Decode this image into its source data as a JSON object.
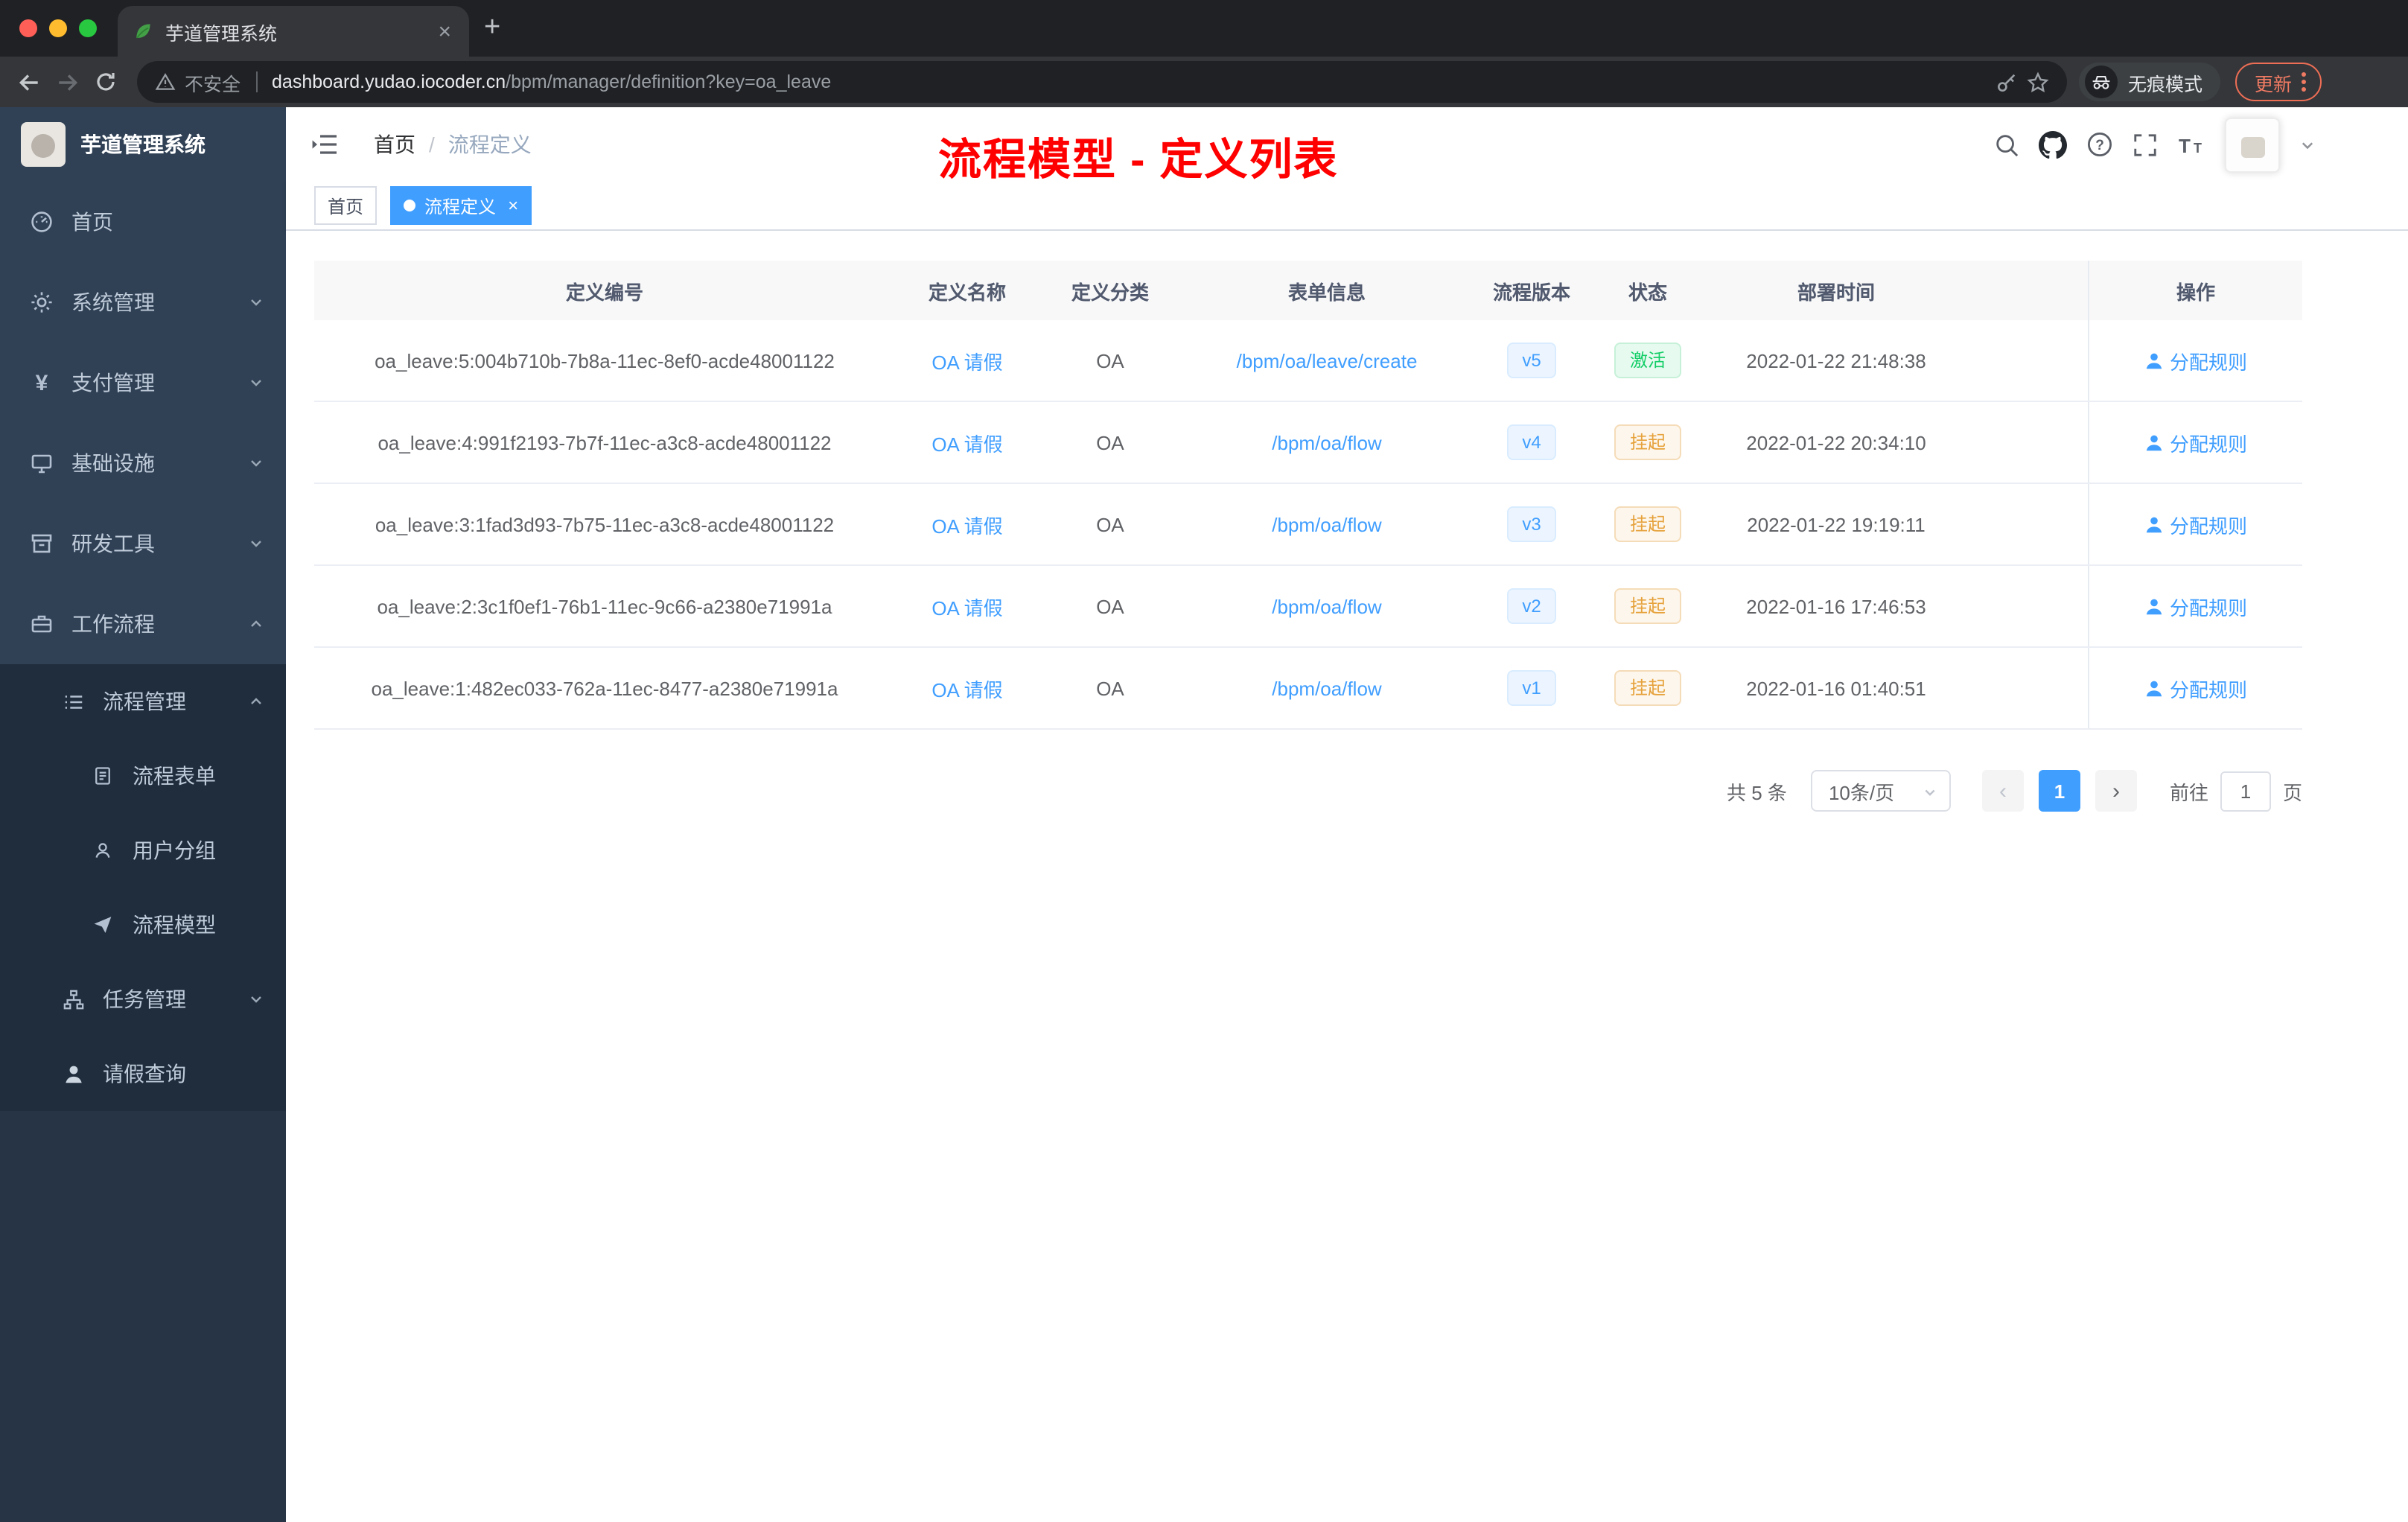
{
  "browser": {
    "tab_title": "芋道管理系统",
    "tab_close": "×",
    "new_tab": "+",
    "security_label": "不安全",
    "url_domain": "dashboard.yudao.iocoder.cn",
    "url_path": "/bpm/manager/definition?key=oa_leave",
    "incognito_label": "无痕模式",
    "update_label": "更新",
    "icons": {
      "favicon": "leaf",
      "back": "arrow-left",
      "forward": "arrow-right",
      "reload": "circular-arrow",
      "security": "alert-triangle",
      "key": "key",
      "star": "star-outline",
      "incognito": "spy-glasses",
      "menu": "vertical-dots"
    }
  },
  "sidebar": {
    "logo_title": "芋道管理系统",
    "items": [
      {
        "label": "首页",
        "icon": "dashboard"
      },
      {
        "label": "系统管理",
        "icon": "gear",
        "chevron": "down"
      },
      {
        "label": "支付管理",
        "icon": "yen",
        "chevron": "down"
      },
      {
        "label": "基础设施",
        "icon": "monitor",
        "chevron": "down"
      },
      {
        "label": "研发工具",
        "icon": "archive",
        "chevron": "down"
      },
      {
        "label": "工作流程",
        "icon": "briefcase",
        "chevron": "up"
      }
    ],
    "submenu": {
      "process_label": "流程管理",
      "children": [
        {
          "label": "流程表单",
          "icon": "document"
        },
        {
          "label": "用户分组",
          "icon": "user-group"
        },
        {
          "label": "流程模型",
          "icon": "paper-plane"
        }
      ],
      "task_label": "任务管理",
      "leave_label": "请假查询"
    }
  },
  "header": {
    "breadcrumb_home": "首页",
    "breadcrumb_separator": "/",
    "breadcrumb_current": "流程定义",
    "annotation": "流程模型 - 定义列表",
    "icons": {
      "hamburger": "fold-menu",
      "search": "magnifier",
      "github": "octocat",
      "help": "question-circle",
      "fullscreen": "expand-corners",
      "font_size": "double-T",
      "avatar_caret": "chevron-down"
    }
  },
  "tags": {
    "home": "首页",
    "current": "流程定义",
    "close": "×"
  },
  "table": {
    "columns": [
      "定义编号",
      "定义名称",
      "定义分类",
      "表单信息",
      "流程版本",
      "状态",
      "部署时间",
      "操作"
    ],
    "rows": [
      {
        "id": "oa_leave:5:004b710b-7b8a-11ec-8ef0-acde48001122",
        "name": "OA 请假",
        "category": "OA",
        "form": "/bpm/oa/leave/create",
        "version": "v5",
        "status": "激活",
        "status_type": "success",
        "time": "2022-01-22 21:48:38",
        "action": "分配规则"
      },
      {
        "id": "oa_leave:4:991f2193-7b7f-11ec-a3c8-acde48001122",
        "name": "OA 请假",
        "category": "OA",
        "form": "/bpm/oa/flow",
        "version": "v4",
        "status": "挂起",
        "status_type": "warning",
        "time": "2022-01-22 20:34:10",
        "action": "分配规则"
      },
      {
        "id": "oa_leave:3:1fad3d93-7b75-11ec-a3c8-acde48001122",
        "name": "OA 请假",
        "category": "OA",
        "form": "/bpm/oa/flow",
        "version": "v3",
        "status": "挂起",
        "status_type": "warning",
        "time": "2022-01-22 19:19:11",
        "action": "分配规则"
      },
      {
        "id": "oa_leave:2:3c1f0ef1-76b1-11ec-9c66-a2380e71991a",
        "name": "OA 请假",
        "category": "OA",
        "form": "/bpm/oa/flow",
        "version": "v2",
        "status": "挂起",
        "status_type": "warning",
        "time": "2022-01-16 17:46:53",
        "action": "分配规则"
      },
      {
        "id": "oa_leave:1:482ec033-762a-11ec-8477-a2380e71991a",
        "name": "OA 请假",
        "category": "OA",
        "form": "/bpm/oa/flow",
        "version": "v1",
        "status": "挂起",
        "status_type": "warning",
        "time": "2022-01-16 01:40:51",
        "action": "分配规则"
      }
    ]
  },
  "pagination": {
    "total": "共 5 条",
    "page_size": "10条/页",
    "prev": "‹",
    "next": "›",
    "current_page": "1",
    "goto_label": "前往",
    "goto_value": "1",
    "page_unit": "页"
  },
  "colors": {
    "accent": "#409eff",
    "success": "#13ce66",
    "warning": "#e6a23c",
    "annotation_red": "#fe0000",
    "sidebar_bg": "#304156",
    "submenu_bg": "#1f2d3d"
  }
}
